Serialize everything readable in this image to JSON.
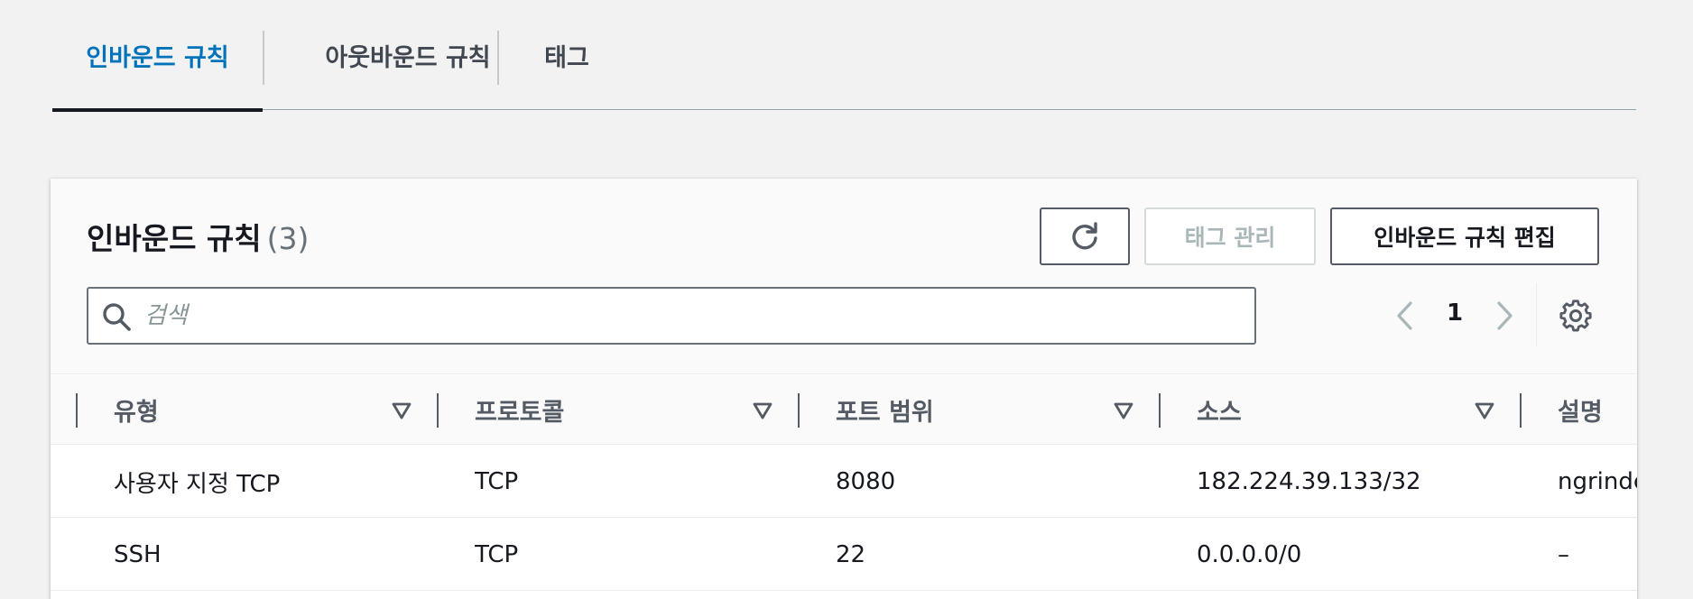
{
  "tabs": [
    {
      "label": "인바운드 규칙",
      "active": true
    },
    {
      "label": "아웃바운드 규칙",
      "active": false
    },
    {
      "label": "태그",
      "active": false
    }
  ],
  "panel": {
    "title": "인바운드 규칙",
    "count": "(3)",
    "buttons": {
      "refresh_icon": "refresh-icon",
      "manage_tags": "태그 관리",
      "edit_rules": "인바운드 규칙 편집"
    },
    "search": {
      "placeholder": "검색",
      "value": ""
    },
    "pagination": {
      "current_page": "1"
    }
  },
  "table": {
    "columns": [
      "유형",
      "프로토콜",
      "포트 범위",
      "소스",
      "설명"
    ],
    "rows": [
      [
        "사용자 지정 TCP",
        "TCP",
        "8080",
        "182.224.39.133/32",
        "ngrinder"
      ],
      [
        "SSH",
        "TCP",
        "22",
        "0.0.0.0/0",
        "–"
      ]
    ]
  },
  "colors": {
    "accent": "#0073bb",
    "text": "#16191f",
    "muted": "#545b64",
    "disabled": "#aab7b8"
  }
}
